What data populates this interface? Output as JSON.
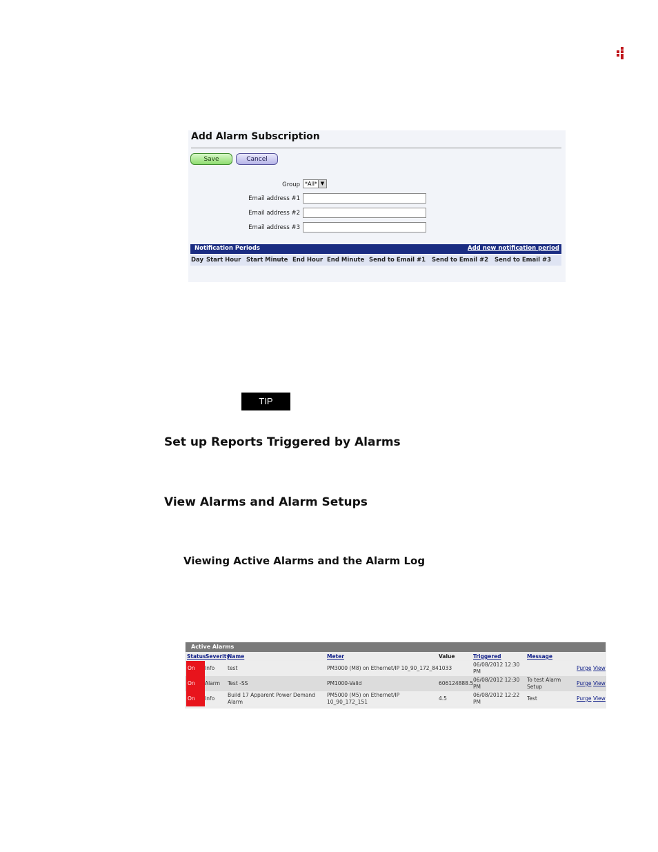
{
  "logo": {
    "name": "brand-logo",
    "color": "#c0151b"
  },
  "subscription": {
    "title": "Add Alarm Subscription",
    "save_label": "Save",
    "cancel_label": "Cancel",
    "group_label": "Group",
    "group_value": "*All*",
    "email1_label": "Email address #1",
    "email2_label": "Email address #2",
    "email3_label": "Email address #3",
    "email1_value": "",
    "email2_value": "",
    "email3_value": "",
    "notification_title": "Notification Periods",
    "add_period_link": "Add new notification period",
    "columns": [
      "Day",
      "Start Hour",
      "Start Minute",
      "End Hour",
      "End Minute",
      "Send to Email #1",
      "Send to Email #2",
      "Send to Email #3"
    ]
  },
  "tip_label": "TIP",
  "headings": {
    "reports": "Set up Reports Triggered by Alarms",
    "view_alarms": "View Alarms and Alarm Setups",
    "active_log": "Viewing Active Alarms and the Alarm Log"
  },
  "active_alarms": {
    "title": "Active Alarms",
    "columns": [
      "Status",
      "Severity",
      "Name",
      "Meter",
      "Value",
      "Triggered",
      "Message"
    ],
    "purge_label": "Purge",
    "view_label": "View",
    "status_color": "#e8141c",
    "rows": [
      {
        "status": "On",
        "severity": "Info",
        "name": "test",
        "name2": "",
        "meter": "PM3000 (M8) on Ethernet/IP 10_90_172_84",
        "meter2": "",
        "value": "1033",
        "triggered": "06/08/2012 12:30",
        "triggered2": "PM",
        "message": "",
        "message2": ""
      },
      {
        "status": "On",
        "severity": "Alarm",
        "name": "Test -SS",
        "name2": "",
        "meter": "PM1000-Valid",
        "meter2": "",
        "value": "606124888.5",
        "triggered": "06/08/2012 12:30",
        "triggered2": "PM",
        "message": "To test Alarm",
        "message2": "Setup"
      },
      {
        "status": "On",
        "severity": "Info",
        "name": "Build 17 Apparent Power Demand",
        "name2": "Alarm",
        "meter": "PM5000 (M5) on Ethernet/IP",
        "meter2": "10_90_172_151",
        "value": "4.5",
        "triggered": "06/08/2012 12:22",
        "triggered2": "PM",
        "message": "Test",
        "message2": ""
      }
    ]
  }
}
